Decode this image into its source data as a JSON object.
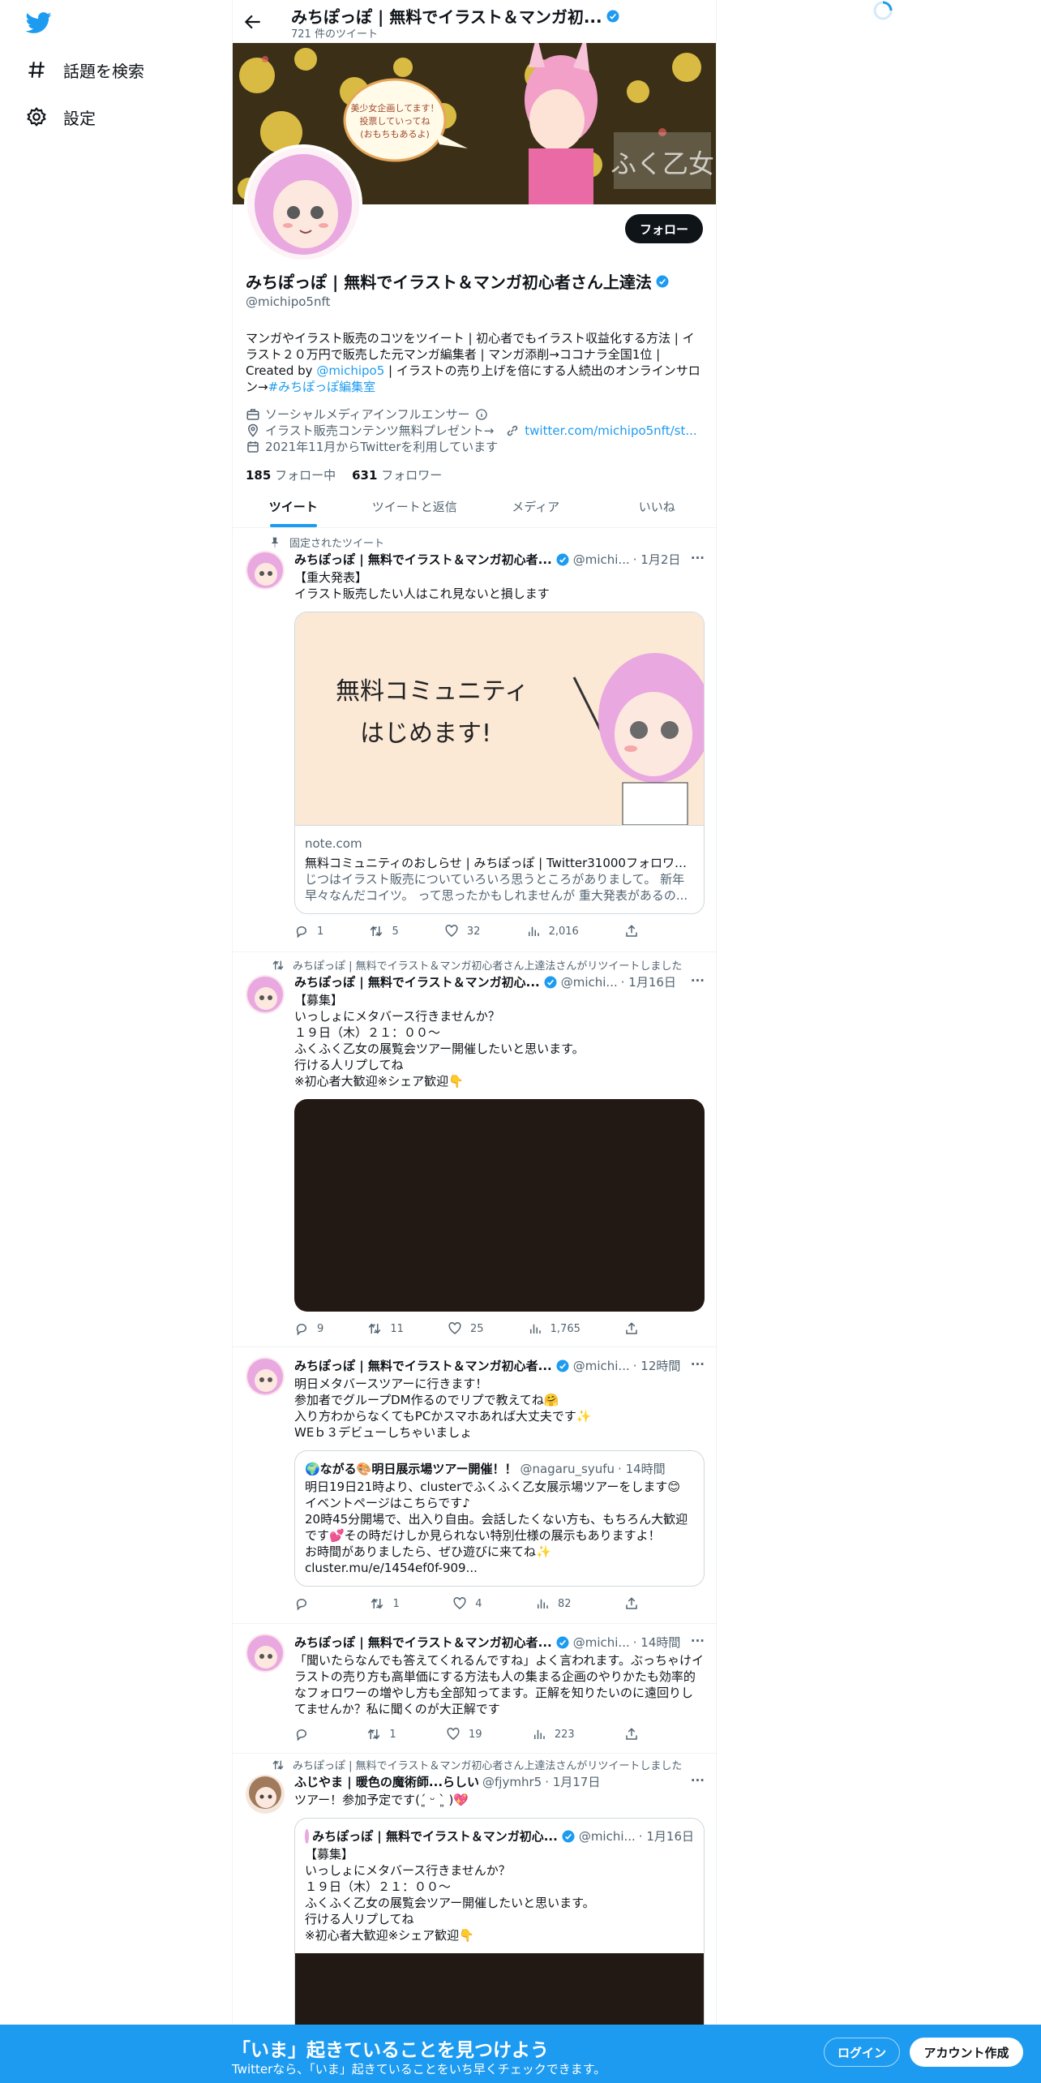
{
  "nav": {
    "explore_label": "話題を検索",
    "settings_label": "設定"
  },
  "header": {
    "title": "みちぽっぽ | 無料でイラスト＆マンガ初...",
    "tweet_count": "721 件のツイート"
  },
  "banner": {
    "bubble_text": "美少女企画してます！\n投票していってね\n(おもちもあるよ)",
    "logo_text": "ふく乙女"
  },
  "profile": {
    "follow_label": "フォロー",
    "name": "みちぽっぽ | 無料でイラスト＆マンガ初心者さん上達法",
    "handle": "@michipo5nft",
    "bio_1": "マンガやイラスト販売のコツをツイート | 初心者でもイラスト収益化する方法 | イラスト２０万円で販売した元マンガ編集者 |  マンガ添削→ココナラ全国1位 | Created by ",
    "bio_mention": "@michipo5",
    "bio_2": " | イラストの売り上げを倍にする人続出のオンラインサロン→",
    "bio_hashtag": "#みちぽっぽ編集室",
    "category": "ソーシャルメディアインフルエンサー",
    "location": "イラスト販売コンテンツ無料プレゼント→",
    "url": "twitter.com/michipo5nft/st...",
    "joined": "2021年11月からTwitterを利用しています",
    "following_count": "185",
    "following_label": "フォロー中",
    "followers_count": "631",
    "followers_label": "フォロワー"
  },
  "tabs": [
    "ツイート",
    "ツイートと返信",
    "メディア",
    "いいね"
  ],
  "tweets": [
    {
      "context": "固定されたツイート",
      "name": "みちぽっぽ | 無料でイラスト＆マンガ初心者...",
      "handle": "@michi...",
      "time": "· 1月2日",
      "text": "【重大発表】\nイラスト販売したい人はこれ見ないと損します",
      "card_image_text_1": "無料コミュニティ",
      "card_image_text_2": "はじめます!",
      "card_domain": "note.com",
      "card_title": "無料コミュニティのおしらせ | みちぽっぽ | Twitter31000フォロワー...",
      "card_desc": "じつはイラスト販売についていろいろ思うところがありまして。 新年早々なんだコイツ。 って思ったかもしれませんが 重大発表があるの...",
      "replies": "1",
      "retweets": "5",
      "likes": "32",
      "views": "2,016"
    },
    {
      "context": "みちぽっぽ | 無料でイラスト＆マンガ初心者さん上達法さんがリツイートしました",
      "name": "みちぽっぽ | 無料でイラスト＆マンガ初心...",
      "handle": "@michi...",
      "time": "· 1月16日",
      "text": "【募集】\nいっしょにメタバース行きませんか？\n１９日（木）２１：００～\nふくふく乙女の展覧会ツアー開催したいと思います。\n行ける人リプしてね\n※初心者大歓迎※シェア歓迎👇",
      "replies": "9",
      "retweets": "11",
      "likes": "25",
      "views": "1,765"
    },
    {
      "name": "みちぽっぽ | 無料でイラスト＆マンガ初心者...",
      "handle": "@michi...",
      "time": "· 12時間",
      "text": "明日メタバースツアーに行きます！\n参加者でグループDM作るのでリプで教えてね🤗\n入り方わからなくてもPCかスマホあれば大丈夫です✨\nWEｂ３デビューしちゃいましょ",
      "quote_name": "🌍ながる🎨明日展示場ツアー開催！！",
      "quote_handle": "@nagaru_syufu",
      "quote_time": "· 14時間",
      "quote_text": "明日19日21時より、clusterでふくふく乙女展示場ツアーをします😊\nイベントページはこちらです♪\n20時45分開場で、出入り自由。会話したくない方も、もちろん大歓迎です💕その時だけしか見られない特別仕様の展示もありますよ！\nお時間がありましたら、ぜひ遊びに来てね✨\ncluster.mu/e/1454ef0f-909...",
      "replies": "",
      "retweets": "1",
      "likes": "4",
      "views": "82"
    },
    {
      "name": "みちぽっぽ | 無料でイラスト＆マンガ初心者...",
      "handle": "@michi...",
      "time": "· 14時間",
      "text": "「聞いたらなんでも答えてくれるんですね」よく言われます。ぶっちゃけイラストの売り方も高単価にする方法も人の集まる企画のやりかたも効率的なフォロワーの増やし方も全部知ってます。正解を知りたいのに遠回りしてませんか？私に聞くのが大正解です",
      "replies": "",
      "retweets": "1",
      "likes": "19",
      "views": "223"
    },
    {
      "context": "みちぽっぽ | 無料でイラスト＆マンガ初心者さん上達法さんがリツイートしました",
      "name": "ふじやま | 暖色の魔術師...らしい",
      "handle": "@fjymhr5",
      "time": "· 1月17日",
      "text": "ツアー！参加予定です(´͈ ᵕ `͈ )💖",
      "quote_name": "みちぽっぽ | 無料でイラスト＆マンガ初心...",
      "quote_handle": "@michi...",
      "quote_time": "· 1月16日",
      "quote_text": "【募集】\nいっしょにメタバース行きませんか？\n１９日（木）２１：００～\nふくふく乙女の展覧会ツアー開催したいと思います。\n行ける人リプしてね\n※初心者大歓迎※シェア歓迎👇"
    }
  ],
  "bottom": {
    "headline": "「いま」起きていることを見つけよう",
    "sub": "Twitterなら、「いま」起きていることをいち早くチェックできます。",
    "login_label": "ログイン",
    "signup_label": "アカウント作成"
  }
}
